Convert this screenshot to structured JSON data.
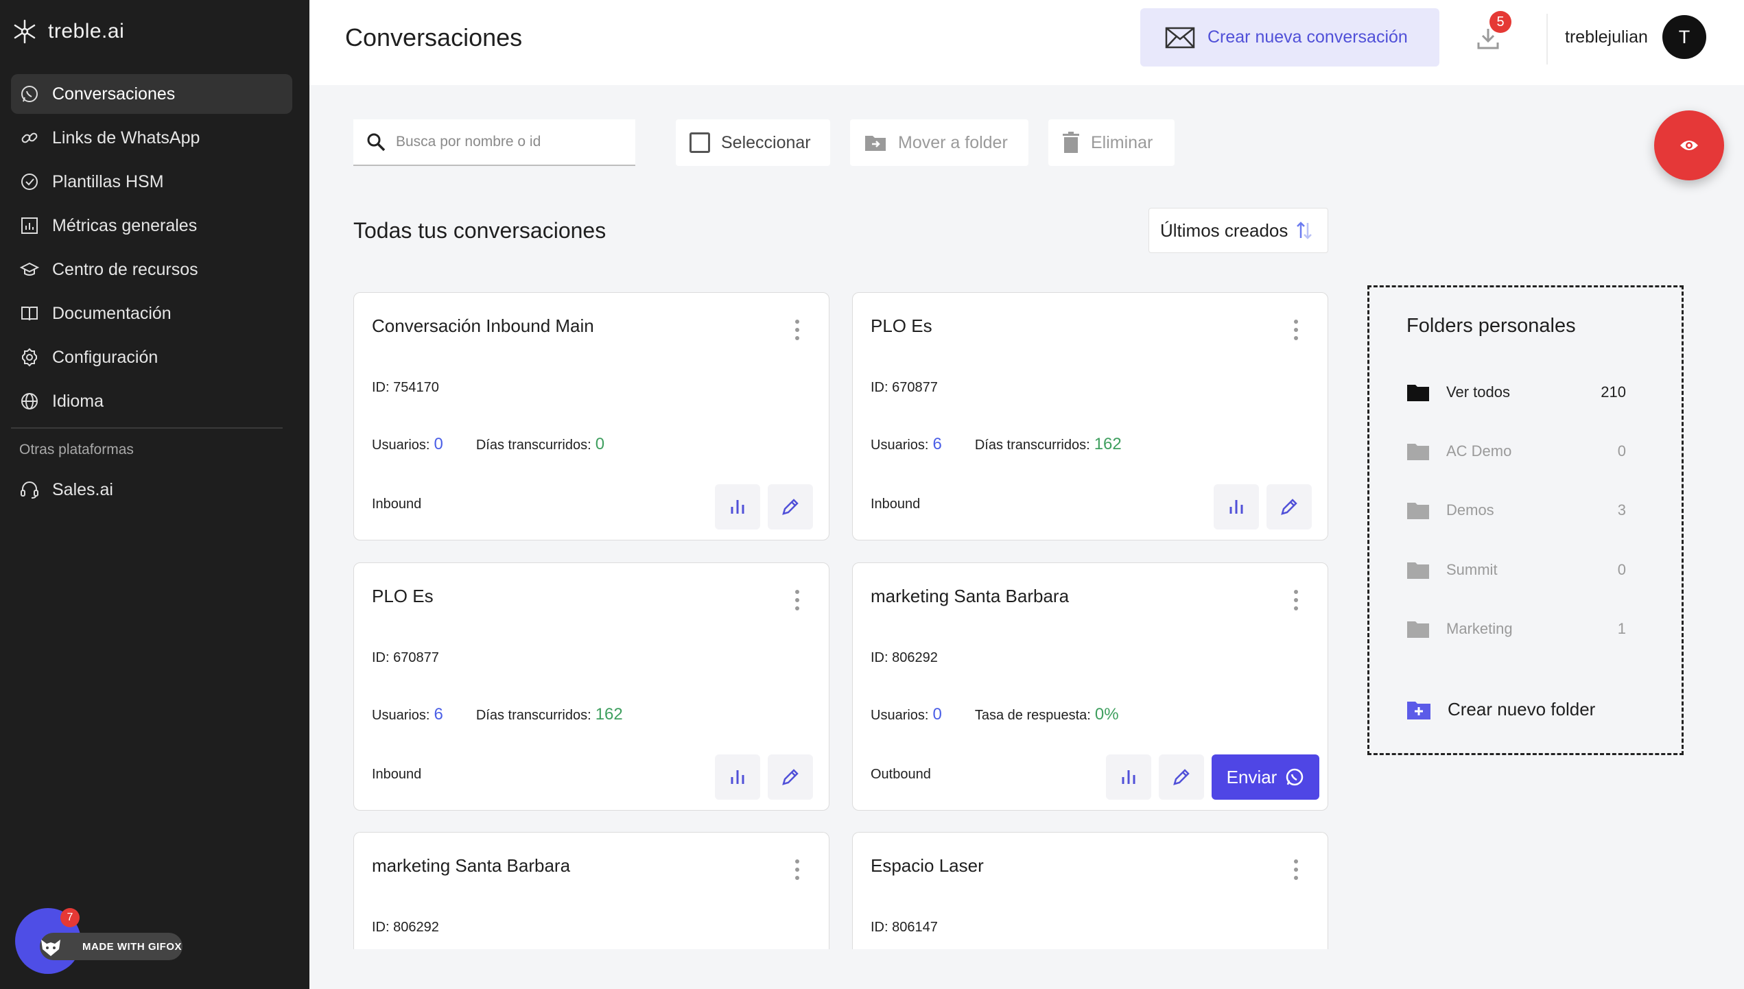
{
  "app": {
    "logo_text": "treble.ai"
  },
  "sidebar": {
    "items": [
      {
        "label": "Conversaciones",
        "icon": "whatsapp-icon",
        "active": true
      },
      {
        "label": "Links de WhatsApp",
        "icon": "link-icon"
      },
      {
        "label": "Plantillas HSM",
        "icon": "check-badge-icon"
      },
      {
        "label": "Métricas generales",
        "icon": "bar-chart-icon"
      },
      {
        "label": "Centro de recursos",
        "icon": "graduation-cap-icon"
      },
      {
        "label": "Documentación",
        "icon": "book-icon"
      },
      {
        "label": "Configuración",
        "icon": "gear-icon"
      },
      {
        "label": "Idioma",
        "icon": "globe-icon"
      }
    ],
    "section_label": "Otras plataformas",
    "other_items": [
      {
        "label": "Sales.ai",
        "icon": "headset-icon"
      }
    ]
  },
  "gifox": {
    "label": "MADE WITH GIFOX",
    "badge": "7"
  },
  "header": {
    "title": "Conversaciones",
    "new_conversation_label": "Crear nueva conversación",
    "download_badge": "5",
    "username": "treblejulian",
    "avatar_initial": "T"
  },
  "toolbar": {
    "search_placeholder": "Busca por nombre o id",
    "select_label": "Seleccionar",
    "move_label": "Mover a folder",
    "delete_label": "Eliminar"
  },
  "list": {
    "title": "Todas tus conversaciones",
    "sort_label": "Últimos creados"
  },
  "cards": [
    {
      "title": "Conversación Inbound Main",
      "id_text": "ID: 754170",
      "users_label": "Usuarios:",
      "users_value": "0",
      "metric_label": "Días transcurridos:",
      "metric_value": "0",
      "type": "Inbound"
    },
    {
      "title": "PLO Es",
      "id_text": "ID: 670877",
      "users_label": "Usuarios:",
      "users_value": "6",
      "metric_label": "Días transcurridos:",
      "metric_value": "162",
      "type": "Inbound"
    },
    {
      "title": "PLO Es",
      "id_text": "ID: 670877",
      "users_label": "Usuarios:",
      "users_value": "6",
      "metric_label": "Días transcurridos:",
      "metric_value": "162",
      "type": "Inbound"
    },
    {
      "title": "marketing Santa Barbara",
      "id_text": "ID: 806292",
      "users_label": "Usuarios:",
      "users_value": "0",
      "metric_label": "Tasa de respuesta:",
      "metric_value": "0%",
      "type": "Outbound",
      "send_label": "Enviar"
    },
    {
      "title": "marketing Santa Barbara",
      "id_text": "ID: 806292"
    },
    {
      "title": "Espacio Laser",
      "id_text": "ID: 806147"
    }
  ],
  "folders": {
    "title": "Folders personales",
    "items": [
      {
        "name": "Ver todos",
        "count": "210"
      },
      {
        "name": "AC Demo",
        "count": "0"
      },
      {
        "name": "Demos",
        "count": "3"
      },
      {
        "name": "Summit",
        "count": "0"
      },
      {
        "name": "Marketing",
        "count": "1"
      }
    ],
    "create_label": "Crear nuevo folder"
  },
  "colors": {
    "sidebar_bg": "#1e1e1e",
    "accent": "#4f46e5",
    "accent_light": "#e8e8fb",
    "badge_red": "#e53935",
    "stat_blue": "#4a5ee6",
    "stat_green": "#3f9f5f"
  }
}
